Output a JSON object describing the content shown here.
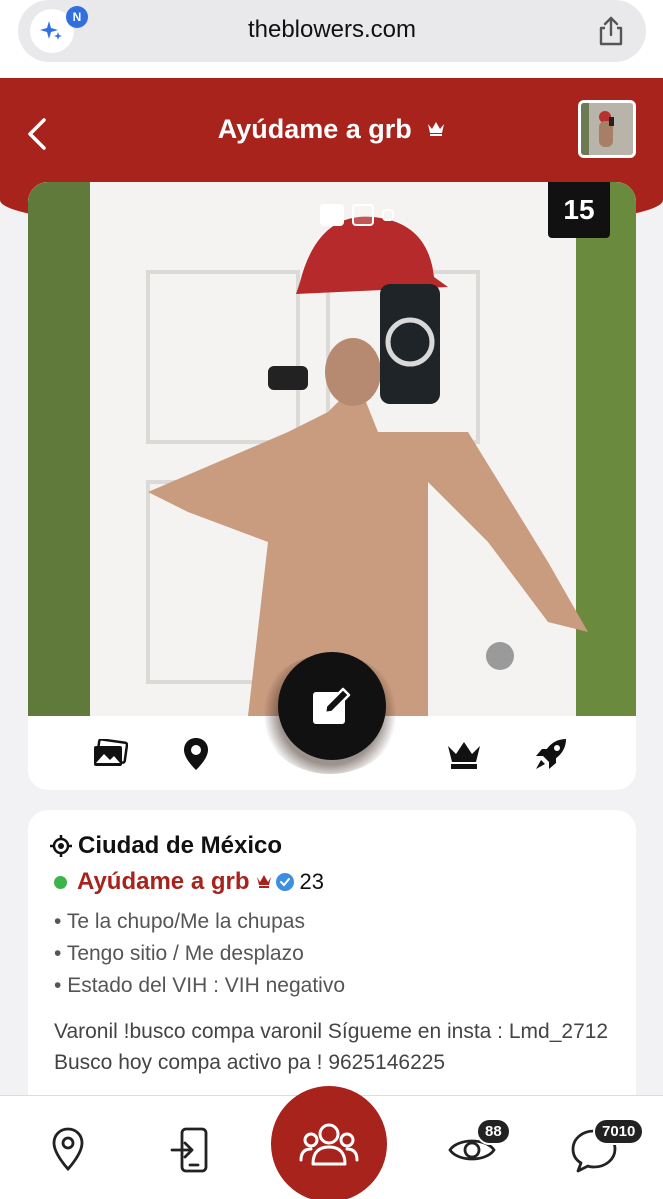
{
  "browser": {
    "url": "theblowers.com",
    "ai_badge": "N"
  },
  "header": {
    "title": "Ayúdame a grb",
    "background": "#a8231c"
  },
  "photo": {
    "counter": "15",
    "pages_total": 3,
    "current_page": 1
  },
  "card_actions": [
    "photos-icon",
    "location-pin-icon",
    "edit-icon",
    "crown-icon",
    "rocket-icon"
  ],
  "profile": {
    "city": "Ciudad de México",
    "name": "Ayúdame a grb",
    "age": "23",
    "online": true,
    "verified": true,
    "traits": [
      "Te la chupo/Me la chupas",
      "Tengo sitio / Me desplazo",
      "Estado del VIH : VIH negativo"
    ],
    "description": "Varonil !busco compa varonil Sígueme en insta : Lmd_2712 Busco hoy compa activo pa ! 9625146225"
  },
  "bottom_nav": {
    "views_badge": "88",
    "messages_badge": "7010"
  }
}
